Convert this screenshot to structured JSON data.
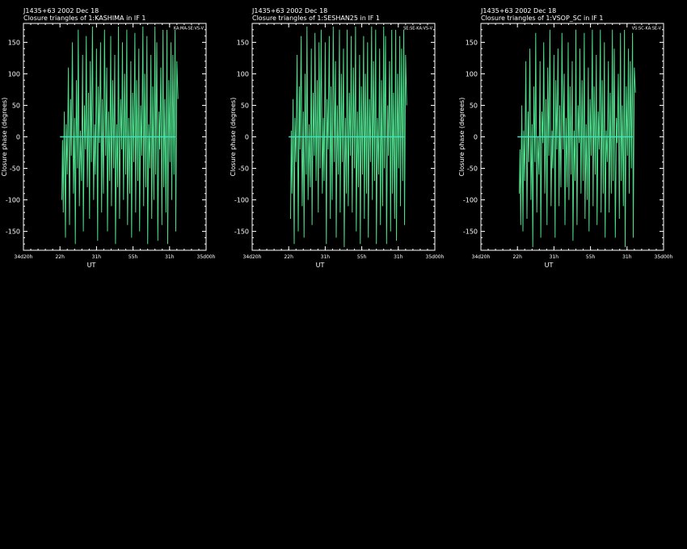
{
  "page": {
    "background": "#000000",
    "foreground": "#ffffff"
  },
  "chart_data": [
    {
      "type": "line",
      "title": "J1435+63  2002 Dec 18",
      "subtitle": "Closure triangles of 1:KASHIMA in IF 1",
      "legend_tag": "KA:MA-SE:VS-V",
      "xlabel": "UT",
      "ylabel": "Closure phase   (degrees)",
      "ylim": [
        -180,
        180
      ],
      "yticks": [
        -150,
        -100,
        -50,
        0,
        50,
        100,
        150
      ],
      "xticks": [
        "34d20h",
        "22h",
        "31h",
        "55h",
        "31h",
        "35d00h"
      ],
      "x_domain": [
        0,
        5
      ],
      "series": [
        {
          "color": "#4fdc8c",
          "x": [
            1.05,
            1.07,
            1.09,
            1.12,
            1.15,
            1.17,
            1.2,
            1.23,
            1.26,
            1.29,
            1.31,
            1.34,
            1.37,
            1.4,
            1.42,
            1.45,
            1.48,
            1.5,
            1.53,
            1.56,
            1.59,
            1.62,
            1.64,
            1.67,
            1.7,
            1.72,
            1.75,
            1.78,
            1.81,
            1.83,
            1.86,
            1.89,
            1.92,
            1.95,
            1.97,
            2.0,
            2.03,
            2.05,
            2.08,
            2.11,
            2.14,
            2.16,
            2.19,
            2.22,
            2.25,
            2.28,
            2.3,
            2.33,
            2.36,
            2.39,
            2.41,
            2.44,
            2.47,
            2.5,
            2.52,
            2.55,
            2.58,
            2.6,
            2.63,
            2.66,
            2.69,
            2.71,
            2.74,
            2.77,
            2.8,
            2.83,
            2.85,
            2.88,
            2.91,
            2.94,
            2.96,
            2.99,
            3.02,
            3.05,
            3.07,
            3.1,
            3.13,
            3.16,
            3.18,
            3.21,
            3.24,
            3.27,
            3.29,
            3.32,
            3.35,
            3.38,
            3.4,
            3.43,
            3.46,
            3.49,
            3.51,
            3.54,
            3.57,
            3.6,
            3.62,
            3.65,
            3.68,
            3.71,
            3.73,
            3.76,
            3.79,
            3.82,
            3.84,
            3.87,
            3.9,
            3.93,
            3.95,
            3.98,
            4.01,
            4.04,
            4.06,
            4.09,
            4.12,
            4.15,
            4.17,
            4.2,
            4.23
          ],
          "y": [
            -100,
            -5,
            -120,
            40,
            -160,
            20,
            -60,
            110,
            -140,
            60,
            -30,
            150,
            -90,
            30,
            -170,
            90,
            -50,
            170,
            -110,
            10,
            -70,
            130,
            -150,
            50,
            -20,
            160,
            -80,
            70,
            -130,
            120,
            -40,
            175,
            -100,
            20,
            -60,
            140,
            -165,
            80,
            -10,
            150,
            -120,
            60,
            -90,
            170,
            -30,
            110,
            -150,
            40,
            -70,
            160,
            -110,
            90,
            -50,
            130,
            -170,
            20,
            -80,
            175,
            -130,
            60,
            -20,
            150,
            -100,
            100,
            -60,
            170,
            -140,
            30,
            -90,
            120,
            -160,
            70,
            -40,
            165,
            -120,
            90,
            -70,
            140,
            -150,
            50,
            -30,
            175,
            -110,
            100,
            -80,
            160,
            -170,
            20,
            -50,
            130,
            -130,
            80,
            -100,
            175,
            -60,
            150,
            -165,
            40,
            -20,
            110,
            -140,
            170,
            -80,
            60,
            -120,
            175,
            -170,
            90,
            -40,
            150,
            -100,
            130,
            -60,
            170,
            -150,
            120,
            60
          ]
        },
        {
          "color": "#40e0c0",
          "x": [
            1.0,
            4.15
          ],
          "y": [
            0,
            0
          ]
        }
      ]
    },
    {
      "type": "line",
      "title": "J1435+63  2002 Dec 18",
      "subtitle": "Closure triangles of 1:SESHAN25 in IF 1",
      "legend_tag": "SE:SE-KA:VS-V",
      "xlabel": "UT",
      "ylabel": "Closure phase   (degrees)",
      "ylim": [
        -180,
        180
      ],
      "yticks": [
        -150,
        -100,
        -50,
        0,
        50,
        100,
        150
      ],
      "xticks": [
        "34d20h",
        "22h",
        "31h",
        "55h",
        "31h",
        "35d00h"
      ],
      "x_domain": [
        0,
        5
      ],
      "series": [
        {
          "color": "#4fdc8c",
          "x": [
            1.05,
            1.07,
            1.09,
            1.12,
            1.15,
            1.17,
            1.2,
            1.23,
            1.26,
            1.29,
            1.31,
            1.34,
            1.37,
            1.4,
            1.42,
            1.45,
            1.48,
            1.5,
            1.53,
            1.56,
            1.59,
            1.62,
            1.64,
            1.67,
            1.7,
            1.72,
            1.75,
            1.78,
            1.81,
            1.83,
            1.86,
            1.89,
            1.92,
            1.95,
            1.97,
            2.0,
            2.03,
            2.05,
            2.08,
            2.11,
            2.14,
            2.16,
            2.19,
            2.22,
            2.25,
            2.28,
            2.3,
            2.33,
            2.36,
            2.39,
            2.41,
            2.44,
            2.47,
            2.5,
            2.52,
            2.55,
            2.58,
            2.6,
            2.63,
            2.66,
            2.69,
            2.71,
            2.74,
            2.77,
            2.8,
            2.83,
            2.85,
            2.88,
            2.91,
            2.94,
            2.96,
            2.99,
            3.02,
            3.05,
            3.07,
            3.1,
            3.13,
            3.16,
            3.18,
            3.21,
            3.24,
            3.27,
            3.29,
            3.32,
            3.35,
            3.38,
            3.4,
            3.43,
            3.46,
            3.49,
            3.51,
            3.54,
            3.57,
            3.6,
            3.62,
            3.65,
            3.68,
            3.71,
            3.73,
            3.76,
            3.79,
            3.82,
            3.84,
            3.87,
            3.9,
            3.93,
            3.95,
            3.98,
            4.01,
            4.04,
            4.06,
            4.09,
            4.12,
            4.15,
            4.17,
            4.2,
            4.23
          ],
          "y": [
            -130,
            10,
            -90,
            60,
            -170,
            30,
            -40,
            130,
            -150,
            80,
            -20,
            160,
            -110,
            40,
            -160,
            100,
            -60,
            175,
            -100,
            20,
            -80,
            140,
            -140,
            70,
            -30,
            165,
            -70,
            90,
            -120,
            150,
            -50,
            170,
            -90,
            30,
            -70,
            150,
            -170,
            60,
            -20,
            160,
            -130,
            80,
            -100,
            175,
            -40,
            120,
            -160,
            50,
            -60,
            170,
            -120,
            100,
            -40,
            140,
            -175,
            30,
            -90,
            170,
            -110,
            70,
            -30,
            160,
            -120,
            110,
            -50,
            175,
            -150,
            40,
            -80,
            130,
            -170,
            80,
            -60,
            160,
            -130,
            100,
            -90,
            150,
            -160,
            60,
            -40,
            175,
            -100,
            120,
            -70,
            170,
            -170,
            30,
            -60,
            140,
            -140,
            90,
            -110,
            175,
            -50,
            160,
            -170,
            50,
            -30,
            120,
            -150,
            175,
            -90,
            70,
            -130,
            175,
            -165,
            100,
            -50,
            160,
            -110,
            140,
            -70,
            175,
            -140,
            130,
            50
          ]
        },
        {
          "color": "#40e0c0",
          "x": [
            1.0,
            4.15
          ],
          "y": [
            0,
            0
          ]
        }
      ]
    },
    {
      "type": "line",
      "title": "J1435+63  2002 Dec 18",
      "subtitle": "Closure triangles of 1:VSOP_SC in IF 1",
      "legend_tag": "VS:SC-KA:SE-V",
      "xlabel": "UT",
      "ylabel": "Closure phase   (degrees)",
      "ylim": [
        -180,
        180
      ],
      "yticks": [
        -150,
        -100,
        -50,
        0,
        50,
        100,
        150
      ],
      "xticks": [
        "34d20h",
        "22h",
        "31h",
        "55h",
        "31h",
        "35d00h"
      ],
      "x_domain": [
        0,
        5
      ],
      "series": [
        {
          "color": "#4fdc8c",
          "x": [
            1.05,
            1.07,
            1.09,
            1.12,
            1.15,
            1.17,
            1.2,
            1.23,
            1.26,
            1.29,
            1.31,
            1.34,
            1.37,
            1.4,
            1.42,
            1.45,
            1.48,
            1.5,
            1.53,
            1.56,
            1.59,
            1.62,
            1.64,
            1.67,
            1.7,
            1.72,
            1.75,
            1.78,
            1.81,
            1.83,
            1.86,
            1.89,
            1.92,
            1.95,
            1.97,
            2.0,
            2.03,
            2.05,
            2.08,
            2.11,
            2.14,
            2.16,
            2.19,
            2.22,
            2.25,
            2.28,
            2.3,
            2.33,
            2.36,
            2.39,
            2.41,
            2.44,
            2.47,
            2.5,
            2.52,
            2.55,
            2.58,
            2.6,
            2.63,
            2.66,
            2.69,
            2.71,
            2.74,
            2.77,
            2.8,
            2.83,
            2.85,
            2.88,
            2.91,
            2.94,
            2.96,
            2.99,
            3.02,
            3.05,
            3.07,
            3.1,
            3.13,
            3.16,
            3.18,
            3.21,
            3.24,
            3.27,
            3.29,
            3.32,
            3.35,
            3.38,
            3.4,
            3.43,
            3.46,
            3.49,
            3.51,
            3.54,
            3.57,
            3.6,
            3.62,
            3.65,
            3.68,
            3.71,
            3.73,
            3.76,
            3.79,
            3.82,
            3.84,
            3.87,
            3.9,
            3.93,
            3.95,
            3.98,
            4.01,
            4.04,
            4.06,
            4.09,
            4.12,
            4.15,
            4.17,
            4.2,
            4.23
          ],
          "y": [
            -90,
            -20,
            -140,
            50,
            -150,
            10,
            -70,
            120,
            -130,
            40,
            -40,
            140,
            -100,
            20,
            -175,
            80,
            -40,
            165,
            -120,
            0,
            -60,
            120,
            -160,
            40,
            -10,
            150,
            -90,
            60,
            -140,
            110,
            -30,
            170,
            -110,
            10,
            -50,
            130,
            -160,
            90,
            -20,
            140,
            -110,
            50,
            -80,
            165,
            -20,
            100,
            -140,
            30,
            -80,
            150,
            -100,
            80,
            -60,
            120,
            -165,
            10,
            -70,
            170,
            -140,
            50,
            -10,
            140,
            -90,
            90,
            -70,
            165,
            -130,
            20,
            -100,
            110,
            -150,
            60,
            -30,
            170,
            -110,
            80,
            -60,
            130,
            -140,
            40,
            -20,
            170,
            -120,
            90,
            -90,
            150,
            -160,
            10,
            -40,
            120,
            -120,
            70,
            -90,
            170,
            -70,
            140,
            -160,
            30,
            -10,
            100,
            -130,
            165,
            -70,
            50,
            -110,
            170,
            -175,
            80,
            -30,
            140,
            -90,
            120,
            -50,
            165,
            -160,
            110,
            70
          ]
        },
        {
          "color": "#40e0c0",
          "x": [
            1.0,
            4.15
          ],
          "y": [
            0,
            0
          ]
        }
      ]
    }
  ]
}
